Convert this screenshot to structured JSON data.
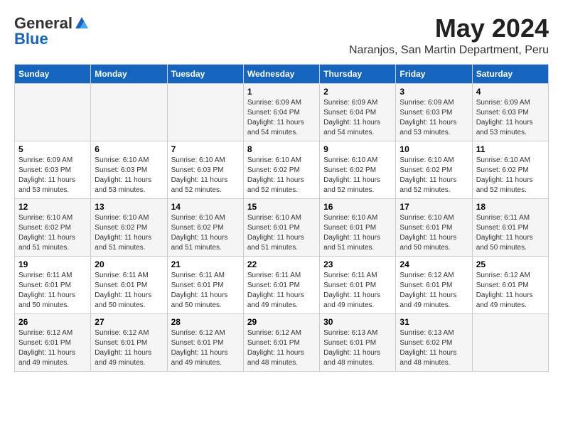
{
  "logo": {
    "general": "General",
    "blue": "Blue"
  },
  "header": {
    "month_year": "May 2024",
    "location": "Naranjos, San Martin Department, Peru"
  },
  "days": [
    "Sunday",
    "Monday",
    "Tuesday",
    "Wednesday",
    "Thursday",
    "Friday",
    "Saturday"
  ],
  "weeks": [
    [
      {
        "date": "",
        "sunrise": "",
        "sunset": "",
        "daylight": ""
      },
      {
        "date": "",
        "sunrise": "",
        "sunset": "",
        "daylight": ""
      },
      {
        "date": "",
        "sunrise": "",
        "sunset": "",
        "daylight": ""
      },
      {
        "date": "1",
        "sunrise": "Sunrise: 6:09 AM",
        "sunset": "Sunset: 6:04 PM",
        "daylight": "Daylight: 11 hours and 54 minutes."
      },
      {
        "date": "2",
        "sunrise": "Sunrise: 6:09 AM",
        "sunset": "Sunset: 6:04 PM",
        "daylight": "Daylight: 11 hours and 54 minutes."
      },
      {
        "date": "3",
        "sunrise": "Sunrise: 6:09 AM",
        "sunset": "Sunset: 6:03 PM",
        "daylight": "Daylight: 11 hours and 53 minutes."
      },
      {
        "date": "4",
        "sunrise": "Sunrise: 6:09 AM",
        "sunset": "Sunset: 6:03 PM",
        "daylight": "Daylight: 11 hours and 53 minutes."
      }
    ],
    [
      {
        "date": "5",
        "sunrise": "Sunrise: 6:09 AM",
        "sunset": "Sunset: 6:03 PM",
        "daylight": "Daylight: 11 hours and 53 minutes."
      },
      {
        "date": "6",
        "sunrise": "Sunrise: 6:10 AM",
        "sunset": "Sunset: 6:03 PM",
        "daylight": "Daylight: 11 hours and 53 minutes."
      },
      {
        "date": "7",
        "sunrise": "Sunrise: 6:10 AM",
        "sunset": "Sunset: 6:03 PM",
        "daylight": "Daylight: 11 hours and 52 minutes."
      },
      {
        "date": "8",
        "sunrise": "Sunrise: 6:10 AM",
        "sunset": "Sunset: 6:02 PM",
        "daylight": "Daylight: 11 hours and 52 minutes."
      },
      {
        "date": "9",
        "sunrise": "Sunrise: 6:10 AM",
        "sunset": "Sunset: 6:02 PM",
        "daylight": "Daylight: 11 hours and 52 minutes."
      },
      {
        "date": "10",
        "sunrise": "Sunrise: 6:10 AM",
        "sunset": "Sunset: 6:02 PM",
        "daylight": "Daylight: 11 hours and 52 minutes."
      },
      {
        "date": "11",
        "sunrise": "Sunrise: 6:10 AM",
        "sunset": "Sunset: 6:02 PM",
        "daylight": "Daylight: 11 hours and 52 minutes."
      }
    ],
    [
      {
        "date": "12",
        "sunrise": "Sunrise: 6:10 AM",
        "sunset": "Sunset: 6:02 PM",
        "daylight": "Daylight: 11 hours and 51 minutes."
      },
      {
        "date": "13",
        "sunrise": "Sunrise: 6:10 AM",
        "sunset": "Sunset: 6:02 PM",
        "daylight": "Daylight: 11 hours and 51 minutes."
      },
      {
        "date": "14",
        "sunrise": "Sunrise: 6:10 AM",
        "sunset": "Sunset: 6:02 PM",
        "daylight": "Daylight: 11 hours and 51 minutes."
      },
      {
        "date": "15",
        "sunrise": "Sunrise: 6:10 AM",
        "sunset": "Sunset: 6:01 PM",
        "daylight": "Daylight: 11 hours and 51 minutes."
      },
      {
        "date": "16",
        "sunrise": "Sunrise: 6:10 AM",
        "sunset": "Sunset: 6:01 PM",
        "daylight": "Daylight: 11 hours and 51 minutes."
      },
      {
        "date": "17",
        "sunrise": "Sunrise: 6:10 AM",
        "sunset": "Sunset: 6:01 PM",
        "daylight": "Daylight: 11 hours and 50 minutes."
      },
      {
        "date": "18",
        "sunrise": "Sunrise: 6:11 AM",
        "sunset": "Sunset: 6:01 PM",
        "daylight": "Daylight: 11 hours and 50 minutes."
      }
    ],
    [
      {
        "date": "19",
        "sunrise": "Sunrise: 6:11 AM",
        "sunset": "Sunset: 6:01 PM",
        "daylight": "Daylight: 11 hours and 50 minutes."
      },
      {
        "date": "20",
        "sunrise": "Sunrise: 6:11 AM",
        "sunset": "Sunset: 6:01 PM",
        "daylight": "Daylight: 11 hours and 50 minutes."
      },
      {
        "date": "21",
        "sunrise": "Sunrise: 6:11 AM",
        "sunset": "Sunset: 6:01 PM",
        "daylight": "Daylight: 11 hours and 50 minutes."
      },
      {
        "date": "22",
        "sunrise": "Sunrise: 6:11 AM",
        "sunset": "Sunset: 6:01 PM",
        "daylight": "Daylight: 11 hours and 49 minutes."
      },
      {
        "date": "23",
        "sunrise": "Sunrise: 6:11 AM",
        "sunset": "Sunset: 6:01 PM",
        "daylight": "Daylight: 11 hours and 49 minutes."
      },
      {
        "date": "24",
        "sunrise": "Sunrise: 6:12 AM",
        "sunset": "Sunset: 6:01 PM",
        "daylight": "Daylight: 11 hours and 49 minutes."
      },
      {
        "date": "25",
        "sunrise": "Sunrise: 6:12 AM",
        "sunset": "Sunset: 6:01 PM",
        "daylight": "Daylight: 11 hours and 49 minutes."
      }
    ],
    [
      {
        "date": "26",
        "sunrise": "Sunrise: 6:12 AM",
        "sunset": "Sunset: 6:01 PM",
        "daylight": "Daylight: 11 hours and 49 minutes."
      },
      {
        "date": "27",
        "sunrise": "Sunrise: 6:12 AM",
        "sunset": "Sunset: 6:01 PM",
        "daylight": "Daylight: 11 hours and 49 minutes."
      },
      {
        "date": "28",
        "sunrise": "Sunrise: 6:12 AM",
        "sunset": "Sunset: 6:01 PM",
        "daylight": "Daylight: 11 hours and 49 minutes."
      },
      {
        "date": "29",
        "sunrise": "Sunrise: 6:12 AM",
        "sunset": "Sunset: 6:01 PM",
        "daylight": "Daylight: 11 hours and 48 minutes."
      },
      {
        "date": "30",
        "sunrise": "Sunrise: 6:13 AM",
        "sunset": "Sunset: 6:01 PM",
        "daylight": "Daylight: 11 hours and 48 minutes."
      },
      {
        "date": "31",
        "sunrise": "Sunrise: 6:13 AM",
        "sunset": "Sunset: 6:02 PM",
        "daylight": "Daylight: 11 hours and 48 minutes."
      },
      {
        "date": "",
        "sunrise": "",
        "sunset": "",
        "daylight": ""
      }
    ]
  ]
}
